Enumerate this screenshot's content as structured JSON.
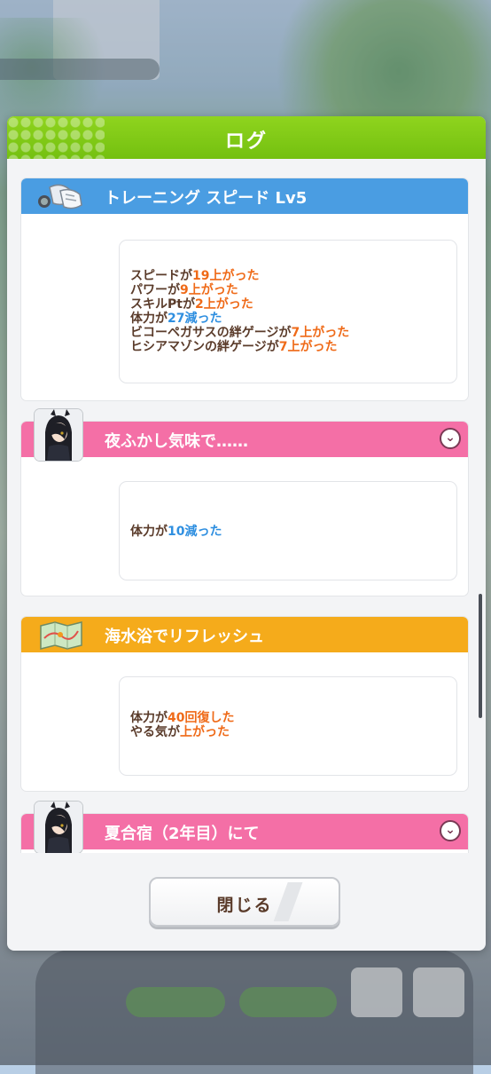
{
  "dialog": {
    "title": "ログ",
    "close_label": "閉じる"
  },
  "entries": [
    {
      "title": "トレーニング スピード Lv5",
      "bar_color": "#4a9de2",
      "icon": "training-shoes-icon",
      "effects": [
        [
          {
            "t": "スピードが",
            "c": "brown"
          },
          {
            "t": "19上がった",
            "c": "org"
          }
        ],
        [
          {
            "t": "パワーが",
            "c": "brown"
          },
          {
            "t": "9上がった",
            "c": "org"
          }
        ],
        [
          {
            "t": "スキルPtが",
            "c": "brown"
          },
          {
            "t": "2上がった",
            "c": "org"
          }
        ],
        [
          {
            "t": "体力が",
            "c": "brown"
          },
          {
            "t": "27減った",
            "c": "blu"
          }
        ],
        [
          {
            "t": "ビコーペガサスの絆ゲージが",
            "c": "brown"
          },
          {
            "t": "7上がった",
            "c": "org"
          }
        ],
        [
          {
            "t": "ヒシアマゾンの絆ゲージが",
            "c": "brown"
          },
          {
            "t": "7上がった",
            "c": "org"
          }
        ]
      ]
    },
    {
      "title": "夜ふかし気味で……",
      "bar_color": "#f46fa6",
      "icon": "character-portrait",
      "effects": [
        [
          {
            "t": "体力が",
            "c": "brown"
          },
          {
            "t": "10減った",
            "c": "blu"
          }
        ]
      ]
    },
    {
      "title": "海水浴でリフレッシュ",
      "bar_color": "#f5ab1b",
      "icon": "map-icon",
      "effects": [
        [
          {
            "t": "体力が",
            "c": "brown"
          },
          {
            "t": "40回復した",
            "c": "org"
          }
        ],
        [
          {
            "t": "やる気が",
            "c": "brown"
          },
          {
            "t": "上がった",
            "c": "org"
          }
        ]
      ]
    },
    {
      "title": "夏合宿（2年目）にて",
      "bar_color": "#f46fa6",
      "icon": "character-portrait"
    }
  ],
  "colors": {
    "header_green": "#74c010",
    "text_brown": "#5a3b2a",
    "increase_orange": "#ef6a18",
    "decrease_blue": "#2f8fe0"
  }
}
